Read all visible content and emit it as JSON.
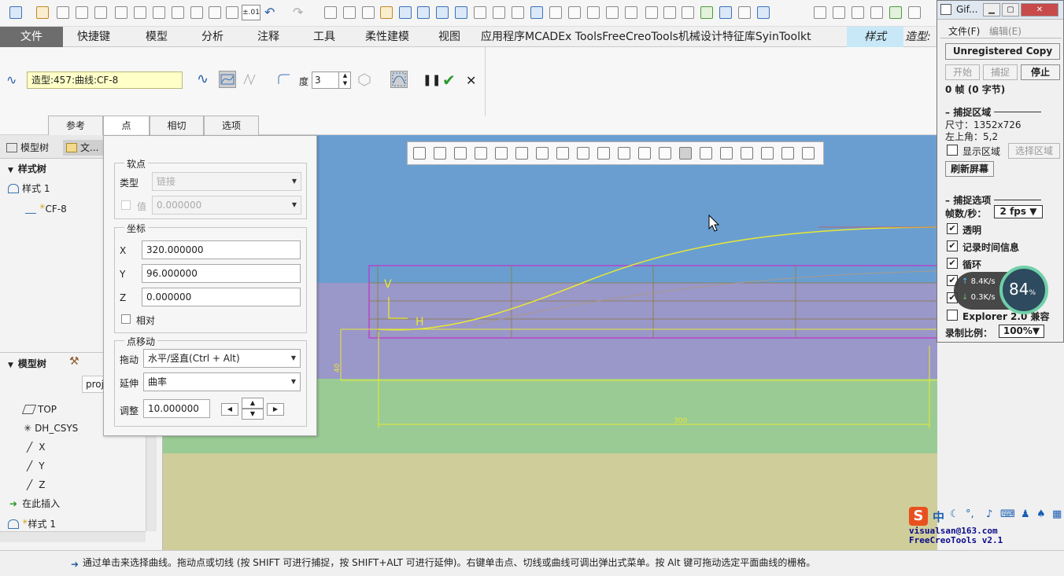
{
  "qat": {
    "precision": "±.01"
  },
  "tabs": [
    {
      "id": "file",
      "label": "文件"
    },
    {
      "id": "shortcut",
      "label": "快捷键"
    },
    {
      "id": "model",
      "label": "模型"
    },
    {
      "id": "analysis",
      "label": "分析"
    },
    {
      "id": "annotate",
      "label": "注释"
    },
    {
      "id": "tools",
      "label": "工具"
    },
    {
      "id": "flex",
      "label": "柔性建模"
    },
    {
      "id": "view",
      "label": "视图"
    },
    {
      "id": "apps",
      "label": "应用程序MCADEx ToolsFreeCreoTools机械设计特征库SyinToolkt"
    },
    {
      "id": "style",
      "label": "样式"
    },
    {
      "id": "modelname",
      "label": "造型:"
    }
  ],
  "ribbon": {
    "curve_name": "造型:457:曲线:CF-8",
    "degree_label": "度",
    "degree_value": "3",
    "subtabs": [
      "参考",
      "点",
      "相切",
      "选项"
    ]
  },
  "tree": {
    "tab_model": "模型树",
    "tab_file": "文...",
    "style_tree": "样式树",
    "style1": "样式 1",
    "cf8": "CF-8",
    "model_tree_header": "模型树",
    "column_header": "proj",
    "items": [
      "TOP",
      "DH_CSYS",
      "X",
      "Y",
      "Z",
      "在此插入",
      "样式 1"
    ]
  },
  "point_panel": {
    "soft_point_title": "软点",
    "type_label": "类型",
    "type_value": "链接",
    "value_label": "值",
    "value_value": "0.000000",
    "coord_title": "坐标",
    "x_label": "X",
    "x_value": "320.000000",
    "y_label": "Y",
    "y_value": "96.000000",
    "z_label": "Z",
    "z_value": "0.000000",
    "relative_label": "相对",
    "move_title": "点移动",
    "drag_label": "拖动",
    "drag_value": "水平/竖直(Ctrl + Alt)",
    "extend_label": "延伸",
    "extend_value": "曲率",
    "adjust_label": "调整",
    "adjust_value": "10.000000"
  },
  "viewport": {
    "label_v": "V",
    "label_h": "H",
    "dim_300": "300",
    "dim_40": "40",
    "colors": {
      "sky": "#6a9ed1",
      "plane": "#9a97c9",
      "ground": "#9acb94",
      "floor": "#cfcd99",
      "curve": "#e8e832",
      "frame": "#c032c8"
    }
  },
  "status": "通过单击来选择曲线。拖动点或切线 (按 SHIFT 可进行捕捉，按 SHIFT+ALT 可进行延伸)。右键单击点、切线或曲线可调出弹出式菜单。按 Alt 键可拖动选定平面曲线的栅格。",
  "gif": {
    "title": "Gif...",
    "menu_file": "文件(F)",
    "menu_edit": "编辑(E)",
    "unregistered": "Unregistered Copy",
    "btn_start": "开始",
    "btn_capture": "捕捉",
    "btn_stop": "停止",
    "frames": "0 帧 (0 字节)",
    "capture_area_title": "捕捉区域",
    "size": "尺寸：1352x726",
    "topleft": "左上角：5,2",
    "show_area": "显示区域",
    "select_area": "选择区域",
    "refresh": "刷新屏幕",
    "capture_options_title": "捕捉选项",
    "fps_label": "帧数/秒：",
    "fps_value": "2 fps",
    "opt_transparent": "透明",
    "opt_timeinfo": "记录时间信息",
    "opt_loop": "循环",
    "opt_explorer": "Explorer 2.0 兼容",
    "scale_label": "录制比例：",
    "scale_value": "100%"
  },
  "net": {
    "up": "8.4K/s",
    "down": "0.3K/s",
    "percent": "84",
    "unit": "%"
  },
  "watermark": {
    "line1": "visualsan@163.com",
    "line2": "FreeCreoTools v2.1"
  },
  "ime": {
    "lang": "中"
  }
}
